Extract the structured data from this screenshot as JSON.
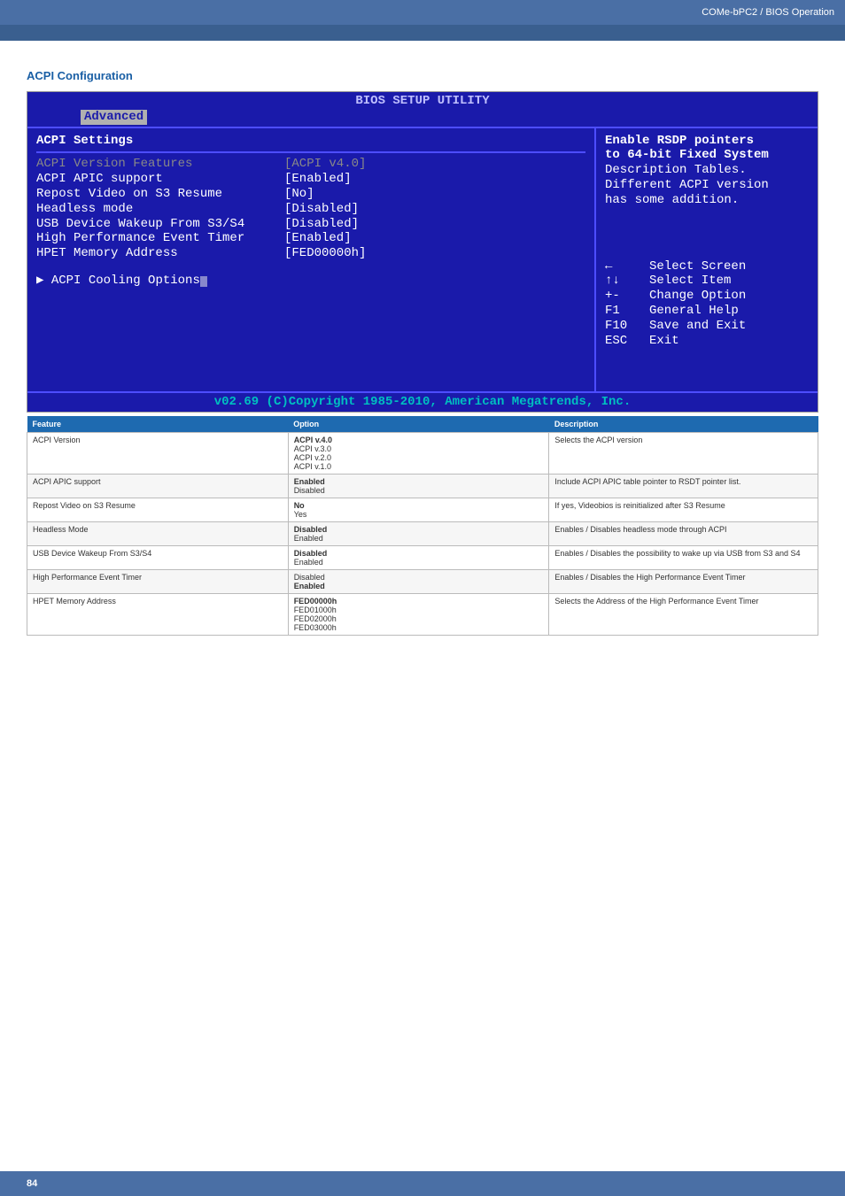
{
  "header": {
    "breadcrumb": "COMe-bPC2 / BIOS Operation"
  },
  "section": {
    "title": "ACPI Configuration"
  },
  "bios": {
    "title": "BIOS SETUP UTILITY",
    "tab": "Advanced",
    "panel_heading": "ACPI Settings",
    "items": [
      {
        "label": "ACPI Version Features",
        "value": "[ACPI v4.0]",
        "sel": true
      },
      {
        "label": "ACPI APIC support",
        "value": "[Enabled]"
      },
      {
        "label": "Repost Video on S3 Resume",
        "value": "[No]"
      },
      {
        "label": "Headless mode",
        "value": "[Disabled]"
      },
      {
        "label": "USB Device Wakeup From S3/S4",
        "value": "[Disabled]"
      },
      {
        "label": "High Performance Event Timer",
        "value": "[Enabled]"
      },
      {
        "label": "HPET Memory Address",
        "value": "[FED00000h]"
      }
    ],
    "submenu": "▶ ACPI Cooling Options",
    "help": {
      "l1": "Enable RSDP pointers",
      "l2": "to 64-bit Fixed System",
      "l3": "Description Tables.",
      "l4": "Different ACPI version",
      "l5": "has some addition."
    },
    "keys": [
      {
        "k": "←",
        "d": "Select Screen"
      },
      {
        "k": "↑↓",
        "d": "Select Item"
      },
      {
        "k": "+-",
        "d": "Change Option"
      },
      {
        "k": "F1",
        "d": "General Help"
      },
      {
        "k": "F10",
        "d": "Save and Exit"
      },
      {
        "k": "ESC",
        "d": "Exit"
      }
    ],
    "footer": "v02.69 (C)Copyright 1985-2010, American Megatrends, Inc."
  },
  "table": {
    "headers": {
      "feature": "Feature",
      "option": "Option",
      "description": "Description"
    },
    "rows": [
      {
        "feature": "ACPI Version",
        "option": "<b>ACPI v.4.0</b><br>ACPI v.3.0<br>ACPI v.2.0<br>ACPI v.1.0",
        "description": "Selects the ACPI version"
      },
      {
        "feature": "ACPI APIC support",
        "option": "<b>Enabled</b><br>Disabled",
        "description": "Include ACPI APIC table pointer to RSDT pointer list."
      },
      {
        "feature": "Repost Video on S3 Resume",
        "option": "<b>No</b><br>Yes",
        "description": "If yes, Videobios is reinitialized after S3 Resume"
      },
      {
        "feature": "Headless Mode",
        "option": "<b>Disabled</b><br>Enabled",
        "description": "Enables / Disables headless mode through ACPI"
      },
      {
        "feature": "USB Device Wakeup From S3/S4",
        "option": "<b>Disabled</b><br>Enabled",
        "description": "Enables / Disables the possibility to wake up via USB from S3 and S4"
      },
      {
        "feature": "High Performance Event Timer",
        "option": "Disabled<br><b>Enabled</b>",
        "description": "Enables / Disables the High Performance Event Timer"
      },
      {
        "feature": "HPET Memory Address",
        "option": "<b>FED00000h</b><br>FED01000h<br>FED02000h<br>FED03000h",
        "description": "Selects the Address of the High Performance Event Timer"
      }
    ]
  },
  "chart_data": {
    "type": "table",
    "title": "ACPI Configuration BIOS Options",
    "columns": [
      "Feature",
      "Option(s) (default first unless noted)",
      "Description"
    ],
    "rows": [
      [
        "ACPI Version",
        "ACPI v.4.0 (default); ACPI v.3.0; ACPI v.2.0; ACPI v.1.0",
        "Selects the ACPI version"
      ],
      [
        "ACPI APIC support",
        "Enabled (default); Disabled",
        "Include ACPI APIC table pointer to RSDT pointer list."
      ],
      [
        "Repost Video on S3 Resume",
        "No (default); Yes",
        "If yes, Videobios is reinitialized after S3 Resume"
      ],
      [
        "Headless Mode",
        "Disabled (default); Enabled",
        "Enables / Disables headless mode through ACPI"
      ],
      [
        "USB Device Wakeup From S3/S4",
        "Disabled (default); Enabled",
        "Enables / Disables the possibility to wake up via USB from S3 and S4"
      ],
      [
        "High Performance Event Timer",
        "Disabled; Enabled (default)",
        "Enables / Disables the High Performance Event Timer"
      ],
      [
        "HPET Memory Address",
        "FED00000h (default); FED01000h; FED02000h; FED03000h",
        "Selects the Address of the High Performance Event Timer"
      ]
    ]
  },
  "footer": {
    "page": "84"
  }
}
